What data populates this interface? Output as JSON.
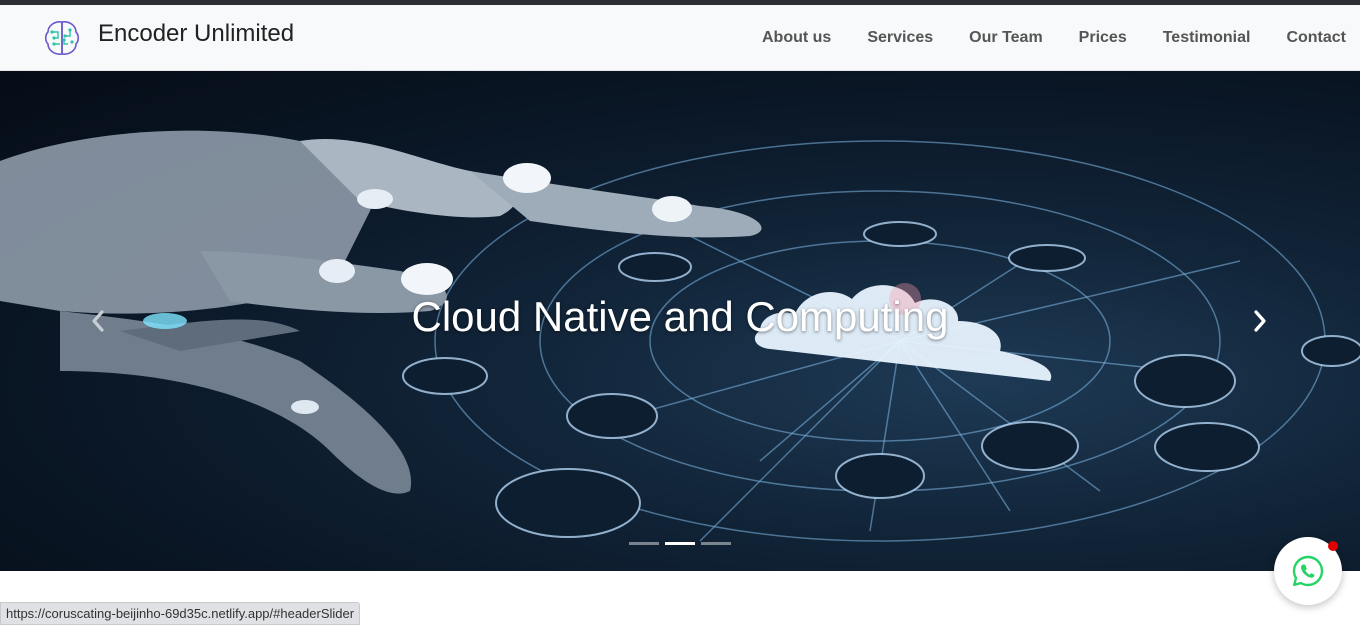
{
  "navbar": {
    "brand": {
      "name": "Encoder Unlimited",
      "logo_icon": "brain-circuit-icon"
    },
    "links": [
      {
        "label": "About us"
      },
      {
        "label": "Services"
      },
      {
        "label": "Our Team"
      },
      {
        "label": "Prices"
      },
      {
        "label": "Testimonial"
      },
      {
        "label": "Contact"
      }
    ]
  },
  "slider": {
    "caption": "Cloud Native and Computing",
    "prev_icon": "chevron-left-icon",
    "next_icon": "chevron-right-icon",
    "slide_count": 3,
    "active_index": 1
  },
  "floating": {
    "icon": "whatsapp-icon",
    "has_notification": true
  },
  "statusbar": {
    "url": "https://coruscating-beijinho-69d35c.netlify.app/#headerSlider"
  },
  "colors": {
    "nav_bg": "#f8f9fa",
    "nav_text": "#555555",
    "slider_bg": "#0a1726",
    "accent_glow": "#cfe8ff",
    "notification": "#e00000",
    "whatsapp": "#25d366"
  }
}
